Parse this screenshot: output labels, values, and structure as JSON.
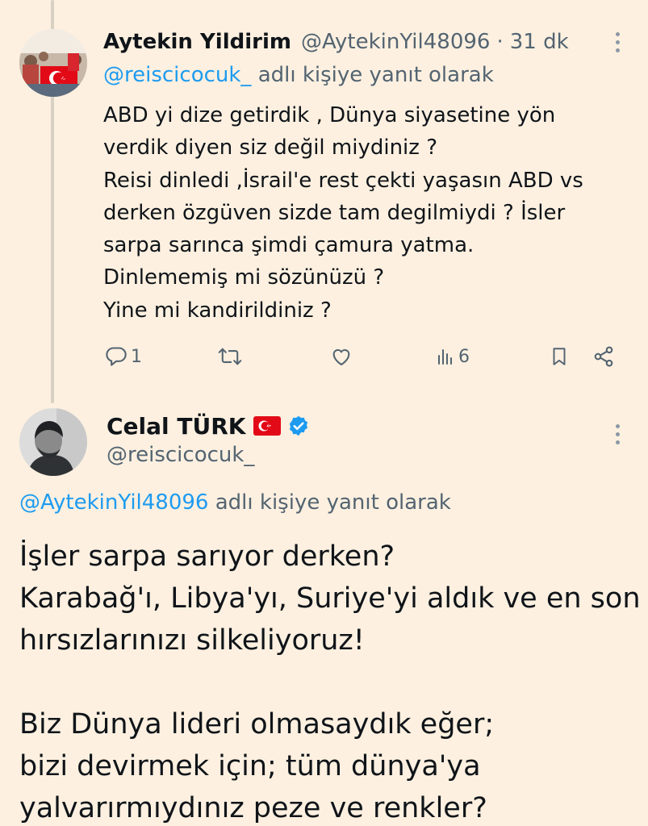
{
  "reply_tweet": {
    "author_name": "Aytekin Yildirim",
    "author_handle": "@AytekinYil48096",
    "separator": "·",
    "time": "31 dk",
    "replying_to_handle": "@reiscicocuk_",
    "replying_to_suffix": "adlı kişiye yanıt olarak",
    "body_lines": [
      "ABD yi dize getirdik , Dünya siyasetine yön",
      "verdik diyen siz değil miydiniz ?",
      "Reisi dinledi ,İsrail'e rest çekti yaşasın ABD vs",
      "derken özgüven sizde tam degilmiydi ? İsler",
      "sarpa sarınca şimdi çamura yatma.",
      "Dinlememiş mi sözünüzü ?",
      "Yine mi kandirildiniz ?"
    ],
    "actions": {
      "reply_count": "1",
      "retweet_count": "",
      "like_count": "",
      "views_count": "6"
    },
    "icons": [
      "avatar-turkish-flag-crowd",
      "reply-icon",
      "retweet-icon",
      "like-icon",
      "views-icon",
      "bookmark-icon",
      "share-icon",
      "more-icon"
    ]
  },
  "main_tweet": {
    "author_name": "Celal TÜRK",
    "author_handle": "@reiscicocuk_",
    "badges": [
      "turkish-flag-emoji",
      "verified-badge"
    ],
    "replying_to_handle": "@AytekinYil48096",
    "replying_to_suffix": "adlı kişiye yanıt olarak",
    "body_lines": [
      "İşler sarpa sarıyor derken?",
      "Karabağ'ı, Libya'yı, Suriye'yi aldık ve en son",
      "hırsızlarınızı silkeliyoruz!",
      "",
      "Biz Dünya lideri olmasaydık eğer;",
      "bizi devirmek için; tüm dünya'ya",
      "yalvarırmıydınız peze ve renkler?"
    ]
  },
  "colors": {
    "background": "#fdf0e0",
    "text": "#0f1419",
    "muted": "#536471",
    "link": "#1d9bf0",
    "verified": "#1d9bf0",
    "flag_red": "#e30a17"
  }
}
